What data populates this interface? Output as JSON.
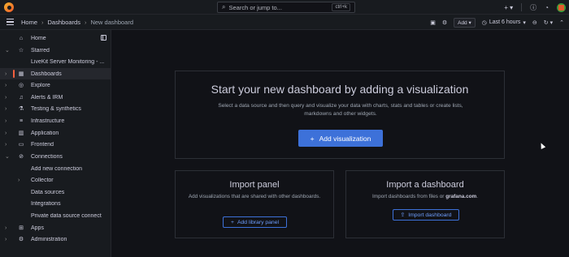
{
  "topbar": {
    "search_placeholder": "Search or jump to...",
    "search_shortcut": "ctrl+k",
    "new_icon": "plus-icon",
    "help_icon": "help-icon",
    "news_icon": "rss-icon"
  },
  "navbar": {
    "breadcrumbs": [
      "Home",
      "Dashboards",
      "New dashboard"
    ],
    "add_label": "Add",
    "time_range": "Last 6 hours"
  },
  "sidebar": {
    "items": [
      {
        "label": "Home",
        "icon": "home-icon"
      },
      {
        "label": "Starred",
        "icon": "star-icon"
      },
      {
        "label": "LiveKit Server Monitoring - ...",
        "icon": ""
      },
      {
        "label": "Dashboards",
        "icon": "apps-icon"
      },
      {
        "label": "Explore",
        "icon": "compass-icon"
      },
      {
        "label": "Alerts & IRM",
        "icon": "bell-icon"
      },
      {
        "label": "Testing & synthetics",
        "icon": "flask-icon"
      },
      {
        "label": "Infrastructure",
        "icon": "server-icon"
      },
      {
        "label": "Application",
        "icon": "chart-icon"
      },
      {
        "label": "Frontend",
        "icon": "frontend-icon"
      },
      {
        "label": "Connections",
        "icon": "link-icon"
      },
      {
        "label": "Add new connection",
        "icon": ""
      },
      {
        "label": "Collector",
        "icon": ""
      },
      {
        "label": "Data sources",
        "icon": ""
      },
      {
        "label": "Integrations",
        "icon": ""
      },
      {
        "label": "Private data source connect",
        "icon": ""
      },
      {
        "label": "Apps",
        "icon": "apps-grid-icon"
      },
      {
        "label": "Administration",
        "icon": "cog-icon"
      }
    ]
  },
  "hero": {
    "title": "Start your new dashboard by adding a visualization",
    "description": "Select a data source and then query and visualize your data with charts, stats and tables or create lists, markdowns and other widgets.",
    "button_label": "Add visualization"
  },
  "import_panel": {
    "title": "Import panel",
    "description": "Add visualizations that are shared with other dashboards.",
    "button_label": "Add library panel"
  },
  "import_dashboard": {
    "title": "Import a dashboard",
    "description_prefix": "Import dashboards from files or ",
    "description_link": "grafana.com",
    "description_suffix": ".",
    "button_label": "Import dashboard"
  },
  "colors": {
    "accent": "#3d71d9",
    "active_marker": "#f55f3e",
    "background": "#111217"
  }
}
